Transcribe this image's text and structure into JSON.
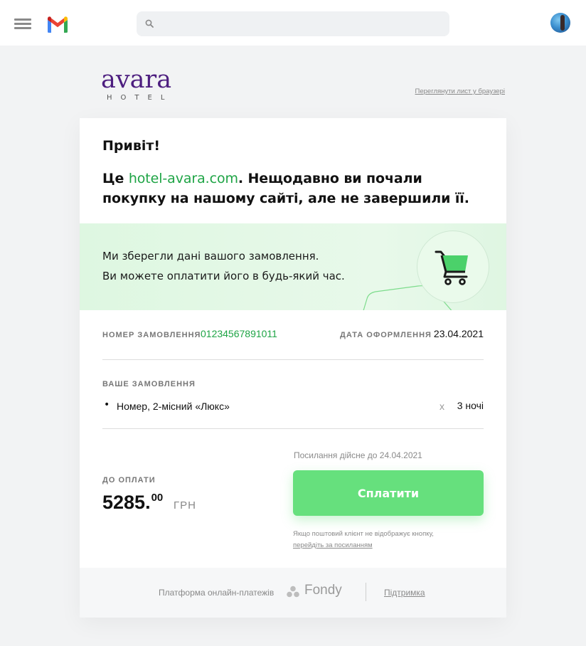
{
  "gmail": {
    "search": {
      "placeholder": "",
      "value": ""
    },
    "menu_icon": "hamburger-icon",
    "logo_icon": "gmail-logo"
  },
  "email": {
    "brand": {
      "name": "avara",
      "sub": "HOTEL",
      "color": "#4d1e7f"
    },
    "view_in_browser": "Переглянути лист у браузері",
    "greeting": "Привіт!",
    "intro": {
      "prefix": "Це ",
      "link": "hotel-avara.com",
      "suffix": ". Нещодавно ви почали покупку на нашому сайті, але не завершили її."
    },
    "saved": {
      "line1": "Ми зберегли дані вашого замовлення.",
      "line2": "Ви можете оплатити його в будь-який час."
    },
    "order": {
      "number_label": "НОМЕР ЗАМОВЛЕННЯ",
      "number": "01234567891011",
      "date_label": "ДАТА ОФОРМЛЕННЯ",
      "date": "23.04.2021"
    },
    "items": {
      "label": "ВАШЕ ЗАМОВЛЕННЯ",
      "list": [
        {
          "name": "Номер, 2-місний «Люкс»",
          "x": "x",
          "qty": "3 ночі"
        }
      ]
    },
    "payment": {
      "valid_until": "Посилання дійсне до 24.04.2021",
      "due_label": "ДО ОПЛАТИ",
      "amount_main": "5285.",
      "amount_cents": "00",
      "currency": "ГРН",
      "pay_button": "Сплатити",
      "hint": "Якщо поштовий клієнт не відображує кнопку,",
      "hint_link": "перейдіть за посиланням",
      "accent": "#66e07d"
    },
    "footer": {
      "platform_text": "Платформа онлайн-платежів",
      "provider": "Fondy",
      "support": "Підтримка"
    }
  }
}
